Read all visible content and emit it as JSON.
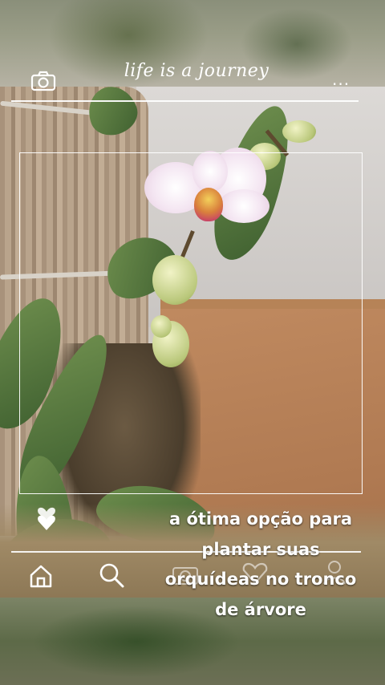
{
  "header": {
    "title": "life is a journey",
    "camera_icon": "camera-icon",
    "more_icon": "more-dots-icon",
    "more_label": "..."
  },
  "post": {
    "caption": "a ótima opção para plantar suas orquídeas no tronco de árvore",
    "like_icon": "heart-icon"
  },
  "bottom_nav": {
    "items": [
      {
        "icon": "home-icon"
      },
      {
        "icon": "search-icon"
      },
      {
        "icon": "camera-icon"
      },
      {
        "icon": "heart-icon"
      },
      {
        "icon": "user-icon"
      }
    ]
  },
  "colors": {
    "overlay_lines": "#ffffff",
    "caption_text": "#ffffff"
  }
}
